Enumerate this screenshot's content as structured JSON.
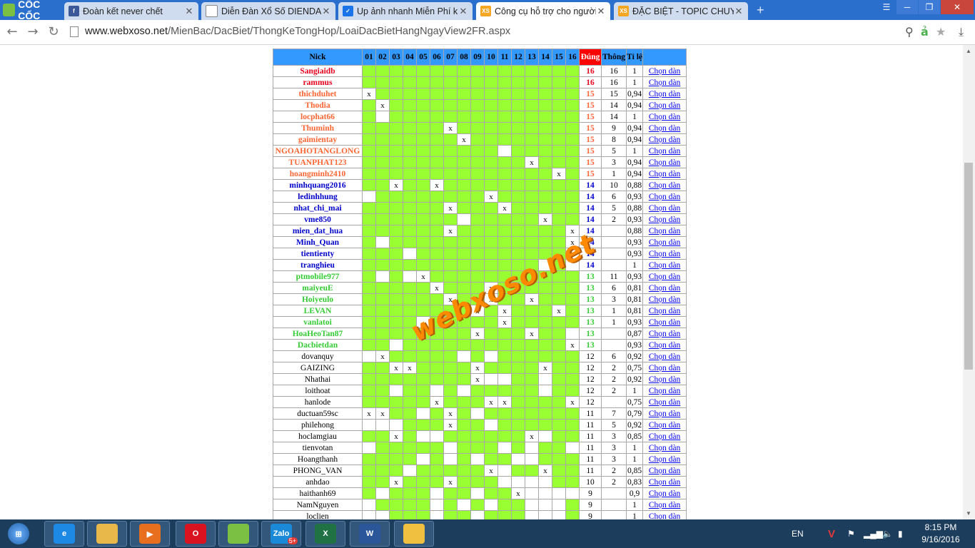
{
  "browser": {
    "logo_label": "CỐC CỐC",
    "tabs": [
      {
        "title": "Đoàn kết never chết",
        "icon": "facebook-icon",
        "color": "#3b5998",
        "glyph": "f",
        "active": false
      },
      {
        "title": "Diễn Đàn Xổ Số DIENDAN",
        "icon": "page-icon",
        "color": "#ffffff",
        "glyph": "",
        "active": false
      },
      {
        "title": "Up ảnh nhanh Miễn Phí khô",
        "icon": "check-icon",
        "color": "#1a73e8",
        "glyph": "✓",
        "active": false
      },
      {
        "title": "Công cụ hỗ trợ cho người",
        "icon": "xs-icon",
        "color": "#f5a623",
        "glyph": "XS",
        "active": true
      },
      {
        "title": "ĐẶC BIỆT - TOPIC CHUYÊN",
        "icon": "xs-icon",
        "color": "#f5a623",
        "glyph": "XS",
        "active": false
      }
    ],
    "url_host": "www.webxoso.net",
    "url_path": "/MienBac/DacBiet/ThongKeTongHop/LoaiDacBietHangNgayView2FR.aspx"
  },
  "table": {
    "headers": {
      "nick": "Nick",
      "cols": [
        "01",
        "02",
        "03",
        "04",
        "05",
        "06",
        "07",
        "08",
        "09",
        "10",
        "11",
        "12",
        "13",
        "14",
        "15",
        "16"
      ],
      "dung": "Đúng",
      "thong": "Thông",
      "tile": "Tỉ lệ"
    },
    "link_label": "Chọn dàn",
    "rows": [
      {
        "nick": "Sangiaidb",
        "color": "#e8001c",
        "x": [],
        "w": [],
        "dung": "16",
        "thong": "16",
        "tile": "1"
      },
      {
        "nick": "rammus",
        "color": "#e8001c",
        "x": [],
        "w": [],
        "dung": "16",
        "thong": "16",
        "tile": "1"
      },
      {
        "nick": "thichduhet",
        "color": "#ff6633",
        "x": [
          1
        ],
        "w": [
          1
        ],
        "dung": "15",
        "thong": "15",
        "tile": "0,94"
      },
      {
        "nick": "Thodia",
        "color": "#ff6633",
        "x": [
          2
        ],
        "w": [
          2
        ],
        "dung": "15",
        "thong": "14",
        "tile": "0,94"
      },
      {
        "nick": "locphat66",
        "color": "#ff6633",
        "x": [],
        "w": [
          2
        ],
        "dung": "15",
        "thong": "14",
        "tile": "1"
      },
      {
        "nick": "Thuminh",
        "color": "#ff6633",
        "x": [
          7
        ],
        "w": [
          7
        ],
        "dung": "15",
        "thong": "9",
        "tile": "0,94"
      },
      {
        "nick": "gaimientay",
        "color": "#ff6633",
        "x": [
          8
        ],
        "w": [
          8
        ],
        "dung": "15",
        "thong": "8",
        "tile": "0,94"
      },
      {
        "nick": "NGOAHOTANGLONG",
        "color": "#ff6633",
        "x": [],
        "w": [
          11
        ],
        "dung": "15",
        "thong": "5",
        "tile": "1"
      },
      {
        "nick": "TUANPHAT123",
        "color": "#ff6633",
        "x": [
          13
        ],
        "w": [
          13
        ],
        "dung": "15",
        "thong": "3",
        "tile": "0,94"
      },
      {
        "nick": "hoangminh2410",
        "color": "#ff6633",
        "x": [
          15
        ],
        "w": [
          15
        ],
        "dung": "15",
        "thong": "1",
        "tile": "0,94"
      },
      {
        "nick": "minhquang2016",
        "color": "#0000cc",
        "x": [
          3,
          6
        ],
        "w": [
          3,
          6
        ],
        "dung": "14",
        "thong": "10",
        "tile": "0,88"
      },
      {
        "nick": "ledinhhung",
        "color": "#0000cc",
        "x": [
          10
        ],
        "w": [
          1,
          10
        ],
        "dung": "14",
        "thong": "6",
        "tile": "0,93"
      },
      {
        "nick": "nhat_chi_mai",
        "color": "#0000cc",
        "x": [
          7,
          11
        ],
        "w": [
          7,
          11
        ],
        "dung": "14",
        "thong": "5",
        "tile": "0,88"
      },
      {
        "nick": "vme850",
        "color": "#0000cc",
        "x": [
          14
        ],
        "w": [
          8,
          14
        ],
        "dung": "14",
        "thong": "2",
        "tile": "0,93"
      },
      {
        "nick": "mien_dat_hua",
        "color": "#0000cc",
        "x": [
          7,
          16
        ],
        "w": [
          7,
          16
        ],
        "dung": "14",
        "thong": "",
        "tile": "0,88"
      },
      {
        "nick": "Minh_Quan",
        "color": "#0000cc",
        "x": [
          16
        ],
        "w": [
          2,
          16
        ],
        "dung": "14",
        "thong": "",
        "tile": "0,93"
      },
      {
        "nick": "tientienty",
        "color": "#0000cc",
        "x": [
          16
        ],
        "w": [
          4,
          16
        ],
        "dung": "14",
        "thong": "",
        "tile": "0,93"
      },
      {
        "nick": "tranghieu",
        "color": "#0000cc",
        "x": [],
        "w": [
          14,
          16
        ],
        "dung": "14",
        "thong": "",
        "tile": "1"
      },
      {
        "nick": "ptmobile977",
        "color": "#33cc33",
        "x": [
          5
        ],
        "w": [
          2,
          4,
          5
        ],
        "dung": "13",
        "thong": "11",
        "tile": "0,93"
      },
      {
        "nick": "maiyeuE",
        "color": "#33cc33",
        "x": [
          6,
          10
        ],
        "w": [
          6,
          10
        ],
        "dung": "13",
        "thong": "6",
        "tile": "0,81"
      },
      {
        "nick": "Hoiyeulo",
        "color": "#33cc33",
        "x": [
          7,
          10,
          13
        ],
        "w": [
          7,
          10,
          13
        ],
        "dung": "13",
        "thong": "3",
        "tile": "0,81"
      },
      {
        "nick": "LEVAN",
        "color": "#33cc33",
        "x": [
          9,
          11,
          15
        ],
        "w": [
          9,
          11,
          15
        ],
        "dung": "13",
        "thong": "1",
        "tile": "0,81"
      },
      {
        "nick": "vanlatoi",
        "color": "#33cc33",
        "x": [
          11
        ],
        "w": [
          5,
          11
        ],
        "dung": "13",
        "thong": "1",
        "tile": "0,93"
      },
      {
        "nick": "HoaHeoTan87",
        "color": "#33cc33",
        "x": [
          9,
          13
        ],
        "w": [
          9,
          13,
          16
        ],
        "dung": "13",
        "thong": "",
        "tile": "0,87"
      },
      {
        "nick": "Dacbietdan",
        "color": "#33cc33",
        "x": [
          16
        ],
        "w": [
          3,
          16
        ],
        "dung": "13",
        "thong": "",
        "tile": "0,93"
      },
      {
        "nick": "dovanquy",
        "color": "#000000",
        "x": [
          2
        ],
        "w": [
          1,
          2,
          8,
          10
        ],
        "dung": "12",
        "thong": "6",
        "tile": "0,92"
      },
      {
        "nick": "GAIZING",
        "color": "#000000",
        "x": [
          3,
          4,
          9,
          14
        ],
        "w": [
          3,
          4,
          9,
          14
        ],
        "dung": "12",
        "thong": "2",
        "tile": "0,75"
      },
      {
        "nick": "Nhathai",
        "color": "#000000",
        "x": [
          9
        ],
        "w": [
          9,
          10,
          11,
          14
        ],
        "dung": "12",
        "thong": "2",
        "tile": "0,92"
      },
      {
        "nick": "loithoat",
        "color": "#000000",
        "x": [],
        "w": [
          3,
          6,
          8,
          14
        ],
        "dung": "12",
        "thong": "2",
        "tile": "1"
      },
      {
        "nick": "hanlode",
        "color": "#000000",
        "x": [
          6,
          10,
          11,
          16
        ],
        "w": [
          6,
          10,
          11,
          16
        ],
        "dung": "12",
        "thong": "",
        "tile": "0,75"
      },
      {
        "nick": "ductuan59sc",
        "color": "#000000",
        "x": [
          1,
          2,
          7
        ],
        "w": [
          1,
          2,
          5,
          7,
          9
        ],
        "dung": "11",
        "thong": "7",
        "tile": "0,79"
      },
      {
        "nick": "philehong",
        "color": "#000000",
        "x": [
          7
        ],
        "w": [
          1,
          2,
          3,
          7,
          10
        ],
        "dung": "11",
        "thong": "5",
        "tile": "0,92"
      },
      {
        "nick": "hoclamgiau",
        "color": "#000000",
        "x": [
          3,
          13
        ],
        "w": [
          3,
          5,
          6,
          13,
          14
        ],
        "dung": "11",
        "thong": "3",
        "tile": "0,85"
      },
      {
        "nick": "tienvotan",
        "color": "#000000",
        "x": [],
        "w": [
          1,
          7,
          11,
          13,
          16
        ],
        "dung": "11",
        "thong": "3",
        "tile": "1"
      },
      {
        "nick": "Hoangthanh",
        "color": "#000000",
        "x": [],
        "w": [
          5,
          7,
          9,
          12,
          13
        ],
        "dung": "11",
        "thong": "3",
        "tile": "1"
      },
      {
        "nick": "PHONG_VAN",
        "color": "#000000",
        "x": [
          10,
          14
        ],
        "w": [
          4,
          10,
          11,
          14
        ],
        "dung": "11",
        "thong": "2",
        "tile": "0,85"
      },
      {
        "nick": "anhdao",
        "color": "#000000",
        "x": [
          3,
          7
        ],
        "w": [
          3,
          7,
          11,
          12,
          13,
          14
        ],
        "dung": "10",
        "thong": "2",
        "tile": "0,83"
      },
      {
        "nick": "haithanh69",
        "color": "#000000",
        "x": [
          12
        ],
        "w": [
          2,
          6,
          9,
          12,
          13,
          14,
          15,
          16
        ],
        "dung": "9",
        "thong": "",
        "tile": "0,9"
      },
      {
        "nick": "NamNguyen",
        "color": "#000000",
        "x": [],
        "w": [
          1,
          6,
          8,
          10,
          13,
          14,
          15
        ],
        "dung": "9",
        "thong": "",
        "tile": "1"
      },
      {
        "nick": "loclien",
        "color": "#000000",
        "x": [],
        "w": [
          1,
          2,
          6,
          9,
          13,
          14,
          15
        ],
        "dung": "9",
        "thong": "",
        "tile": "1"
      }
    ]
  },
  "watermark": "webxoso.net",
  "taskbar": {
    "apps": [
      {
        "name": "ie-icon",
        "label": "e",
        "color": "#1e88e5"
      },
      {
        "name": "file-explorer-icon",
        "label": "",
        "color": "#e8b84a"
      },
      {
        "name": "media-player-icon",
        "label": "▶",
        "color": "#e86f1e"
      },
      {
        "name": "opera-icon",
        "label": "O",
        "color": "#d9131f"
      },
      {
        "name": "coccoc-icon",
        "label": "",
        "color": "#7bc043"
      },
      {
        "name": "zalo-icon",
        "label": "Zalo",
        "color": "#1a8ad8"
      },
      {
        "name": "excel-icon",
        "label": "X",
        "color": "#207245"
      },
      {
        "name": "word-icon",
        "label": "W",
        "color": "#2b579a"
      },
      {
        "name": "paint-icon",
        "label": "",
        "color": "#f0c040"
      }
    ],
    "zalo_badge": "5+",
    "lang": "EN",
    "time": "8:15 PM",
    "date": "9/16/2016"
  }
}
